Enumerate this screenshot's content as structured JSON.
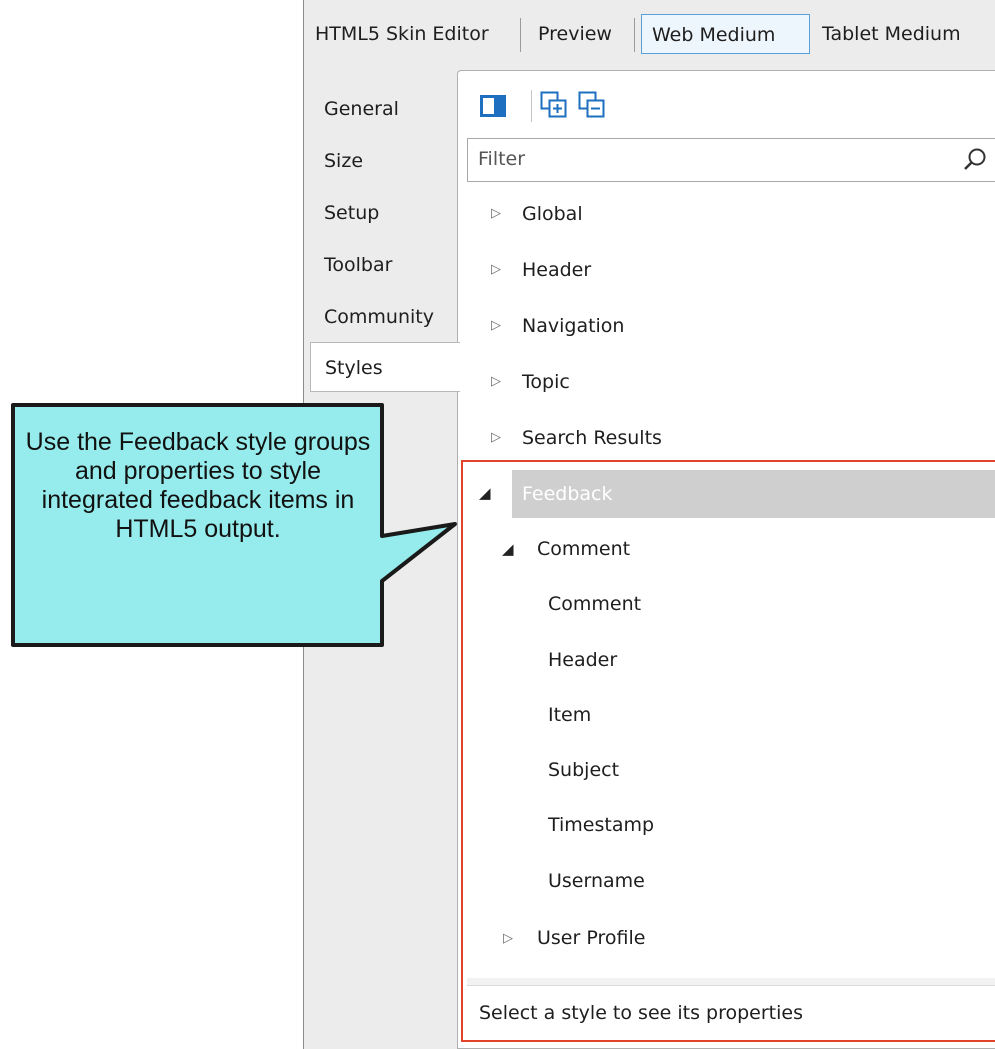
{
  "top_tabs": [
    "HTML5 Skin Editor",
    "Preview",
    "Web Medium",
    "Tablet Medium"
  ],
  "active_top_tab": "Web Medium",
  "side_nav": [
    "General",
    "Size",
    "Setup",
    "Toolbar",
    "Community",
    "Styles"
  ],
  "hidden_nav_fragment": "t",
  "active_side_item": "Styles",
  "toolbar_icons": [
    "panel-toggle-icon",
    "expand-all-icon",
    "collapse-all-icon"
  ],
  "filter": {
    "placeholder": "Filter",
    "value": ""
  },
  "tree": {
    "collapsed_top": [
      "Global",
      "Header",
      "Navigation",
      "Topic",
      "Search Results"
    ],
    "expanded_group": "Feedback",
    "sub_group": "Comment",
    "sub_items": [
      "Comment",
      "Header",
      "Item",
      "Subject",
      "Timestamp",
      "Username"
    ],
    "collapsed_sub": "User Profile"
  },
  "status_text": "Select a style to see its properties",
  "callout": "Use the Feedback style groups and properties to style integrated feedback items in HTML5 output.",
  "colors": {
    "highlight_border": "#e0432a",
    "callout_fill": "#96ecec",
    "selected_row": "#cfcfcf",
    "toolbar_icon": "#1e6fc0"
  }
}
